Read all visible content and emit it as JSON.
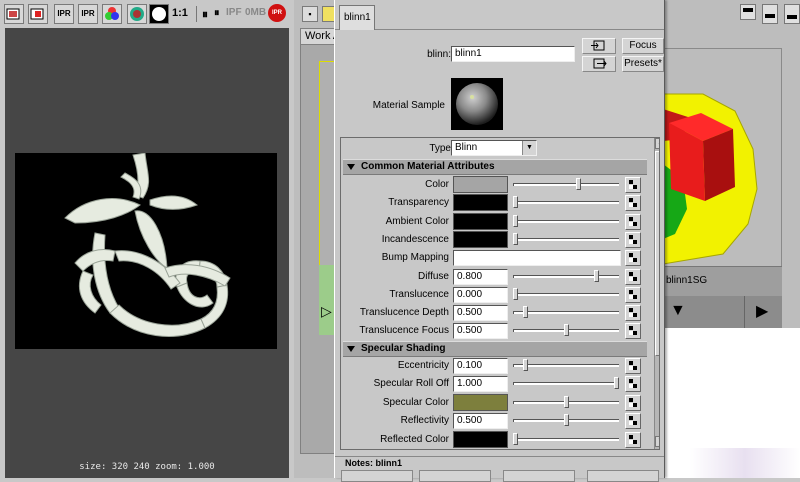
{
  "render_view": {
    "toolbar": {
      "ipr_badge_1": "IPR",
      "ipr_badge_2": "IPR",
      "ratio": "1:1",
      "ipr_text": "IPF",
      "size_text": "0MB",
      "ipr_badge_3": "IPR"
    },
    "status": "size:  320  240 zoom: 1.000"
  },
  "hypershade": {
    "tab_label": "Work A",
    "shading_group": "blinn1SG"
  },
  "attribute_editor": {
    "tab_label": "blinn1",
    "node_label": "blinn:",
    "node_name": "blinn1",
    "focus_button": "Focus",
    "presets_button": "Presets*",
    "material_sample_label": "Material Sample",
    "type_label": "Type",
    "type_value": "Blinn",
    "common_section": "Common Material Attributes",
    "specular_section": "Specular Shading",
    "attrs": {
      "color": {
        "label": "Color",
        "swatch": "#a5a5a5",
        "level": 0.62
      },
      "transparency": {
        "label": "Transparency",
        "swatch": "#000000",
        "level": 0.0
      },
      "ambient": {
        "label": "Ambient Color",
        "swatch": "#000000",
        "level": 0.0
      },
      "incandescence": {
        "label": "Incandescence",
        "swatch": "#000000",
        "level": 0.0
      },
      "bump": {
        "label": "Bump Mapping"
      },
      "diffuse": {
        "label": "Diffuse",
        "value": "0.800",
        "level": 0.8
      },
      "translucence": {
        "label": "Translucence",
        "value": "0.000",
        "level": 0.0
      },
      "trans_depth": {
        "label": "Translucence Depth",
        "value": "0.500",
        "level": 0.1
      },
      "trans_focus": {
        "label": "Translucence Focus",
        "value": "0.500",
        "level": 0.5
      },
      "eccentricity": {
        "label": "Eccentricity",
        "value": "0.100",
        "level": 0.1
      },
      "rolloff": {
        "label": "Specular Roll Off",
        "value": "1.000",
        "level": 1.0
      },
      "spec_color": {
        "label": "Specular Color",
        "swatch": "#7d7f3d",
        "level": 0.5
      },
      "reflectivity": {
        "label": "Reflectivity",
        "value": "0.500",
        "level": 0.5
      },
      "reflected": {
        "label": "Reflected Color",
        "swatch": "#000000",
        "level": 0.0
      }
    },
    "notes_label": "Notes: blinn1"
  }
}
